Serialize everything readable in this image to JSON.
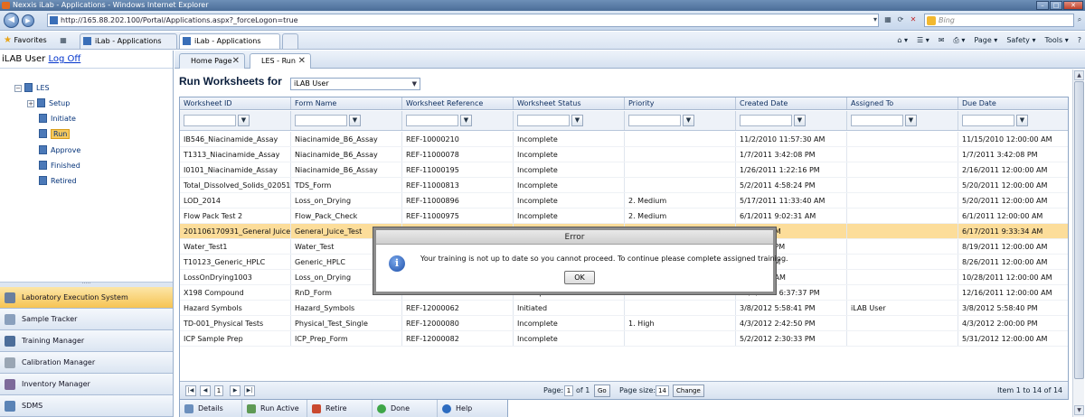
{
  "browser": {
    "window_title": "Nexxis iLab - Applications - Windows Internet Explorer",
    "url": "http://165.88.202.100/Portal/Applications.aspx?_forceLogon=true",
    "search_placeholder": "Bing",
    "favorites_label": "Favorites",
    "tabs": [
      {
        "label": "iLab - Applications"
      },
      {
        "label": "iLab - Applications"
      }
    ],
    "commands": [
      "Page ▾",
      "Safety ▾",
      "Tools ▾",
      "?"
    ]
  },
  "sidebar": {
    "user": "iLAB User",
    "logoff": "Log Off",
    "tree": [
      {
        "label": "LES"
      },
      {
        "label": "Setup"
      },
      {
        "label": "Initiate"
      },
      {
        "label": "Run"
      },
      {
        "label": "Approve"
      },
      {
        "label": "Finished"
      },
      {
        "label": "Retired"
      }
    ],
    "modules": [
      {
        "label": "Laboratory Execution System"
      },
      {
        "label": "Sample Tracker"
      },
      {
        "label": "Training Manager"
      },
      {
        "label": "Calibration Manager"
      },
      {
        "label": "Inventory Manager"
      },
      {
        "label": "SDMS"
      }
    ]
  },
  "app_tabs": [
    {
      "label": "Home Page"
    },
    {
      "label": "LES - Run"
    }
  ],
  "main": {
    "title": "Run Worksheets for",
    "user_select": "iLAB User",
    "columns": [
      "Worksheet ID",
      "Form Name",
      "Worksheet Reference",
      "Worksheet Status",
      "Priority",
      "Created Date",
      "Assigned To",
      "Due Date"
    ],
    "rows": [
      [
        "IB546_Niacinamide_Assay",
        "Niacinamide_B6_Assay",
        "REF-10000210",
        "Incomplete",
        "",
        "11/2/2010 11:57:30 AM",
        "",
        "11/15/2010 12:00:00 AM"
      ],
      [
        "T1313_Niacinamide_Assay",
        "Niacinamide_B6_Assay",
        "REF-11000078",
        "Incomplete",
        "",
        "1/7/2011 3:42:08 PM",
        "",
        "1/7/2011 3:42:08 PM"
      ],
      [
        "I0101_Niacinamide_Assay",
        "Niacinamide_B6_Assay",
        "REF-11000195",
        "Incomplete",
        "",
        "1/26/2011 1:22:16 PM",
        "",
        "2/16/2011 12:00:00 AM"
      ],
      [
        "Total_Dissolved_Solids_020511",
        "TDS_Form",
        "REF-11000813",
        "Incomplete",
        "",
        "5/2/2011 4:58:24 PM",
        "",
        "5/20/2011 12:00:00 AM"
      ],
      [
        "LOD_2014",
        "Loss_on_Drying",
        "REF-11000896",
        "Incomplete",
        "2. Medium",
        "5/17/2011 11:33:40 AM",
        "",
        "5/20/2011 12:00:00 AM"
      ],
      [
        "Flow Pack Test 2",
        "Flow_Pack_Check",
        "REF-11000975",
        "Incomplete",
        "2. Medium",
        "6/1/2011 9:02:31 AM",
        "",
        "6/1/2011 12:00:00 AM"
      ],
      [
        "201106170931_General Juice Test",
        "General_Juice_Test",
        "",
        "",
        "",
        "9:33:34 AM",
        "",
        "6/17/2011 9:33:34 AM"
      ],
      [
        "Water_Test1",
        "Water_Test",
        "",
        "",
        "",
        "12:08:20 PM",
        "",
        "8/19/2011 12:00:00 AM"
      ],
      [
        "T10123_Generic_HPLC",
        "Generic_HPLC",
        "",
        "",
        "",
        "4:37:55 PM",
        "",
        "8/26/2011 12:00:00 AM"
      ],
      [
        "LossOnDrying1003",
        "Loss_on_Drying",
        "",
        "",
        "",
        "10:44:26 AM",
        "",
        "10/28/2011 12:00:00 AM"
      ],
      [
        "X198 Compound",
        "RnD_Form",
        "REF-11001684",
        "Incomplete",
        "2. Medium",
        "12/7/2011 6:37:37 PM",
        "",
        "12/16/2011 12:00:00 AM"
      ],
      [
        "Hazard Symbols",
        "Hazard_Symbols",
        "REF-12000062",
        "Initiated",
        "",
        "3/8/2012 5:58:41 PM",
        "iLAB User",
        "3/8/2012 5:58:40 PM"
      ],
      [
        "TD-001_Physical Tests",
        "Physical_Test_Single",
        "REF-12000080",
        "Incomplete",
        "1. High",
        "4/3/2012 2:42:50 PM",
        "",
        "4/3/2012 2:00:00 PM"
      ],
      [
        "ICP Sample Prep",
        "ICP_Prep_Form",
        "REF-12000082",
        "Incomplete",
        "",
        "5/2/2012 2:30:33 PM",
        "",
        "5/31/2012 12:00:00 AM"
      ]
    ],
    "pager": {
      "current_page": "1",
      "page_label": "Page:",
      "page_value": "1",
      "of_label": "of 1",
      "go_label": "Go",
      "size_label": "Page size:",
      "size_value": "14",
      "change_label": "Change",
      "summary": "Item 1 to 14 of 14"
    },
    "toolbar": [
      {
        "label": "Details"
      },
      {
        "label": "Run Active"
      },
      {
        "label": "Retire"
      },
      {
        "label": "Done"
      },
      {
        "label": "Help"
      }
    ]
  },
  "dialog": {
    "title": "Error",
    "message": "Your training is not up to date so you cannot proceed. To continue please complete assigned training.",
    "ok_label": "OK"
  },
  "colors": {
    "selected_row": "#fcdd9a",
    "active_module": "#f6c453"
  }
}
